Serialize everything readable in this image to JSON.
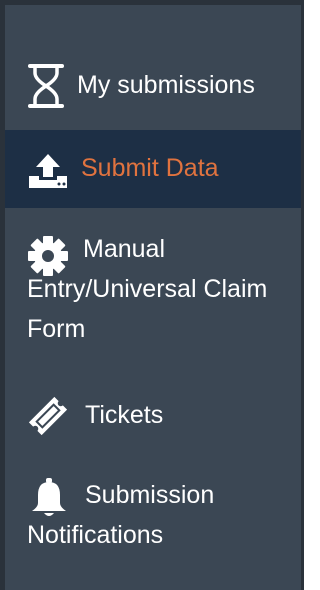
{
  "sidebar": {
    "items": [
      {
        "label": "My submissions",
        "icon": "hourglass-icon",
        "active": false
      },
      {
        "label": "Submit Data",
        "icon": "upload-icon",
        "active": true
      },
      {
        "label": "Manual Entry/Universal Claim Form",
        "icon": "gear-icon",
        "active": false
      },
      {
        "label": "Tickets",
        "icon": "ticket-icon",
        "active": false
      },
      {
        "label": "Submission Notifications",
        "icon": "bell-icon",
        "active": false
      }
    ],
    "colors": {
      "background": "#3b4754",
      "active_background": "#1d2f45",
      "active_text": "#e0733f",
      "text": "#ffffff"
    }
  }
}
